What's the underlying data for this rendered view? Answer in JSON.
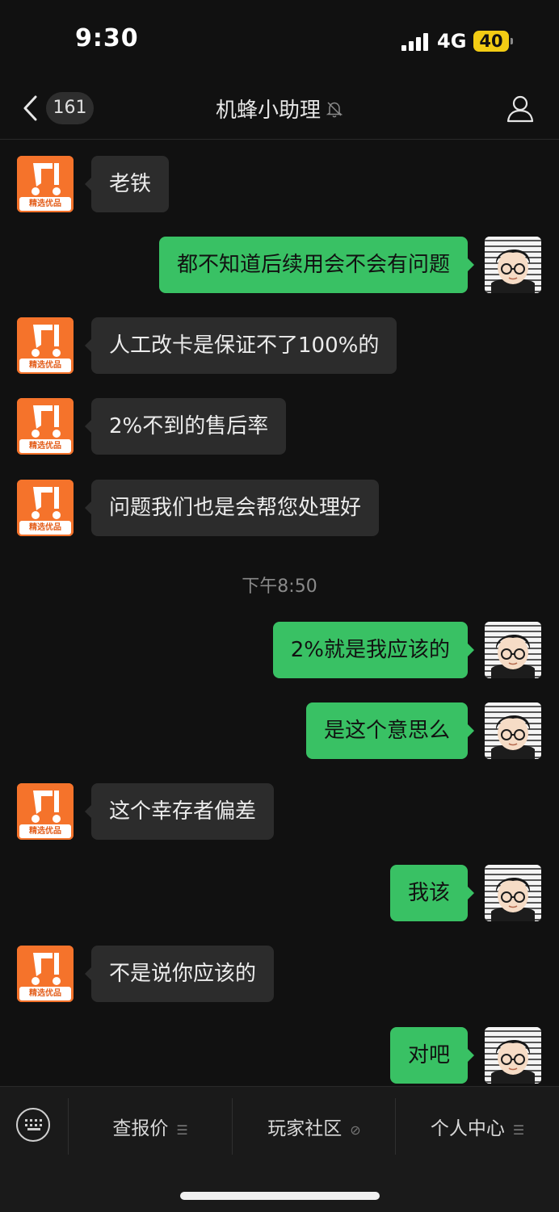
{
  "status_bar": {
    "time": "9:30",
    "network": "4G",
    "battery": "40"
  },
  "nav": {
    "unread_count": "161",
    "title": "机蜂小助理"
  },
  "bot_avatar": {
    "brand_text": "精选优品",
    "color": "#f5732b"
  },
  "accent_colors": {
    "my_bubble": "#39c164",
    "bot_bubble": "#2c2c2c"
  },
  "messages": [
    {
      "from": "bot",
      "text": "老铁"
    },
    {
      "from": "me",
      "text": "都不知道后续用会不会有问题"
    },
    {
      "from": "bot",
      "text": "人工改卡是保证不了100%的"
    },
    {
      "from": "bot",
      "text": "2%不到的售后率"
    },
    {
      "from": "bot",
      "text": "问题我们也是会帮您处理好"
    },
    {
      "from": "me",
      "text": "2%就是我应该的"
    },
    {
      "from": "me",
      "text": "是这个意思么"
    },
    {
      "from": "bot",
      "text": "这个幸存者偏差"
    },
    {
      "from": "me",
      "text": "我该"
    },
    {
      "from": "bot",
      "text": "不是说你应该的"
    },
    {
      "from": "me",
      "text": "对吧"
    }
  ],
  "timestamp": "下午8:50",
  "menu": [
    {
      "label": "查报价",
      "icon": "menu-lines-icon"
    },
    {
      "label": "玩家社区",
      "icon": "link-icon"
    },
    {
      "label": "个人中心",
      "icon": "menu-lines-icon"
    }
  ]
}
